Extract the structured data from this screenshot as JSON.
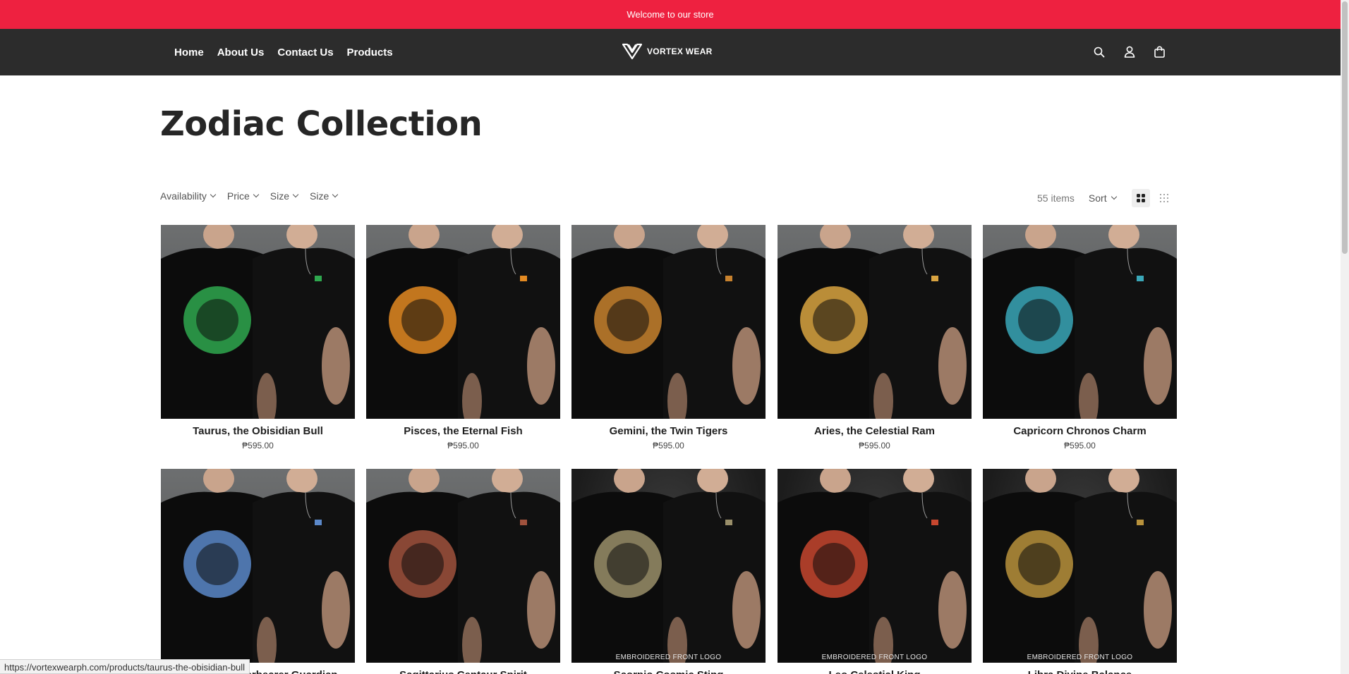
{
  "announcement": {
    "text": "Welcome to our store"
  },
  "header": {
    "nav": [
      "Home",
      "About Us",
      "Contact Us",
      "Products"
    ],
    "logo_text": "VORTEX WEAR",
    "icons": [
      "search-icon",
      "account-icon",
      "cart-icon"
    ]
  },
  "collection": {
    "title": "Zodiac Collection",
    "filters": [
      "Availability",
      "Price",
      "Size",
      "Size"
    ],
    "item_count": "55 items",
    "sort_label": "Sort",
    "view_modes": [
      "grid-large-icon",
      "grid-small-icon"
    ]
  },
  "products": [
    {
      "name": "Taurus, the Obisidian Bull",
      "price": "₱595.00",
      "art_color": "#2fa84f",
      "model": "light"
    },
    {
      "name": "Pisces, the Eternal Fish",
      "price": "₱595.00",
      "art_color": "#e38a22",
      "model": "light"
    },
    {
      "name": "Gemini, the Twin Tigers",
      "price": "₱595.00",
      "art_color": "#c8822e",
      "model": "light"
    },
    {
      "name": "Aries, the Celestial Ram",
      "price": "₱595.00",
      "art_color": "#d9a441",
      "model": "light"
    },
    {
      "name": "Capricorn Chronos Charm",
      "price": "₱595.00",
      "art_color": "#3aa7b8",
      "model": "light"
    },
    {
      "name": "Aquarius Waterbearer Guardian",
      "price": "",
      "art_color": "#5b88c9",
      "model": "light",
      "overlay": ""
    },
    {
      "name": "Sagittarius Centaur Spirit",
      "price": "",
      "art_color": "#a0523d",
      "model": "light",
      "overlay": ""
    },
    {
      "name": "Scorpio Cosmic Sting",
      "price": "",
      "art_color": "#9a8f6a",
      "model": "dark",
      "overlay": "EMBROIDERED FRONT LOGO"
    },
    {
      "name": "Leo Celestial King",
      "price": "",
      "art_color": "#c7472f",
      "model": "dark",
      "overlay": "EMBROIDERED FRONT LOGO"
    },
    {
      "name": "Libra Divine Balance",
      "price": "",
      "art_color": "#b8923c",
      "model": "dark",
      "overlay": "EMBROIDERED FRONT LOGO"
    }
  ],
  "status_bar": {
    "url": "https://vortexwearph.com/products/taurus-the-obisidian-bull"
  }
}
